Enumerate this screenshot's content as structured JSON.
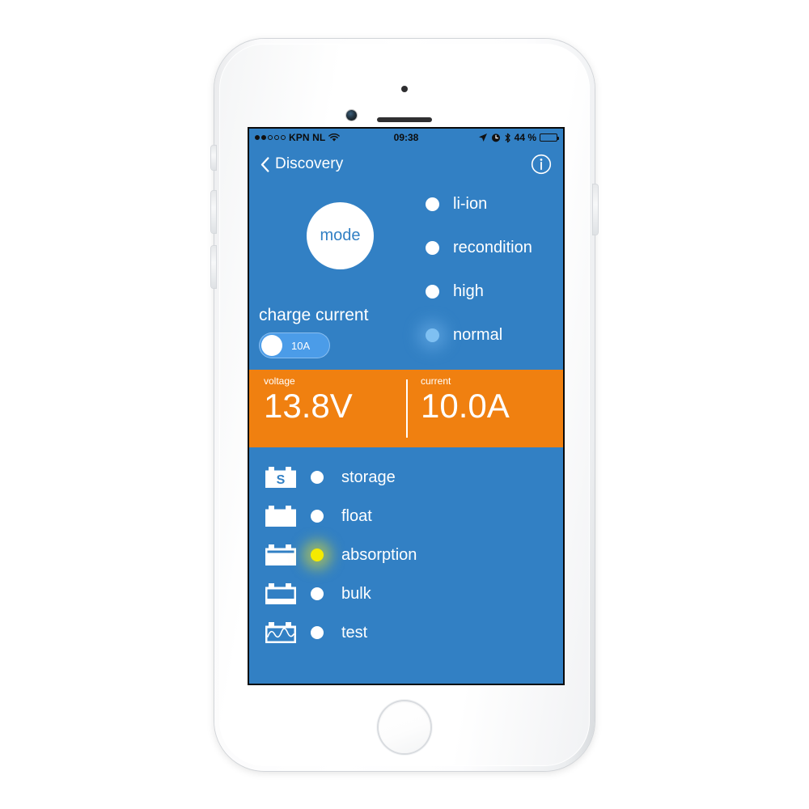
{
  "device": {
    "name": "white-iphone",
    "sensors": [
      "proximity-sensor",
      "front-camera",
      "earpiece-speaker"
    ],
    "home_button": "home-button"
  },
  "status_bar": {
    "signal_strength_filled": 2,
    "signal_strength_total": 5,
    "carrier": "KPN NL",
    "wifi_icon": "wifi-icon",
    "time": "09:38",
    "location_icon": "location-arrow-icon",
    "alarm_icon": "alarm-clock-icon",
    "bluetooth_icon": "bluetooth-icon",
    "battery_percent_label": "44 %",
    "battery_level": 44
  },
  "nav_bar": {
    "back_icon": "chevron-left-icon",
    "back_label": "Discovery",
    "info_icon": "info-circle-icon"
  },
  "mode_section": {
    "button_label": "mode",
    "options": [
      {
        "label": "li-ion",
        "active": false
      },
      {
        "label": "recondition",
        "active": false
      },
      {
        "label": "high",
        "active": false
      },
      {
        "label": "normal",
        "active": true
      }
    ],
    "active_color": "#7fc0f2",
    "inactive_color": "#ffffff"
  },
  "charge_current": {
    "label": "charge current",
    "toggle_value": "10A",
    "toggle_state": "left",
    "track_color": "#4b9ce8",
    "knob_color": "#ffffff"
  },
  "readout": {
    "voltage_label": "voltage",
    "voltage_value": "13.8V",
    "current_label": "current",
    "current_value": "10.0A",
    "panel_color": "#f08010"
  },
  "stages": {
    "active_color": "#f5ea00",
    "inactive_color": "#ffffff",
    "items": [
      {
        "label": "storage",
        "icon": "battery-storage-icon",
        "active": false
      },
      {
        "label": "float",
        "icon": "battery-float-icon",
        "active": false
      },
      {
        "label": "absorption",
        "icon": "battery-absorption-icon",
        "active": true
      },
      {
        "label": "bulk",
        "icon": "battery-bulk-icon",
        "active": false
      },
      {
        "label": "test",
        "icon": "battery-test-icon",
        "active": false
      }
    ]
  },
  "theme": {
    "screen_background": "#3280c4",
    "accent_orange": "#f08010",
    "text_on_blue": "#ffffff"
  }
}
